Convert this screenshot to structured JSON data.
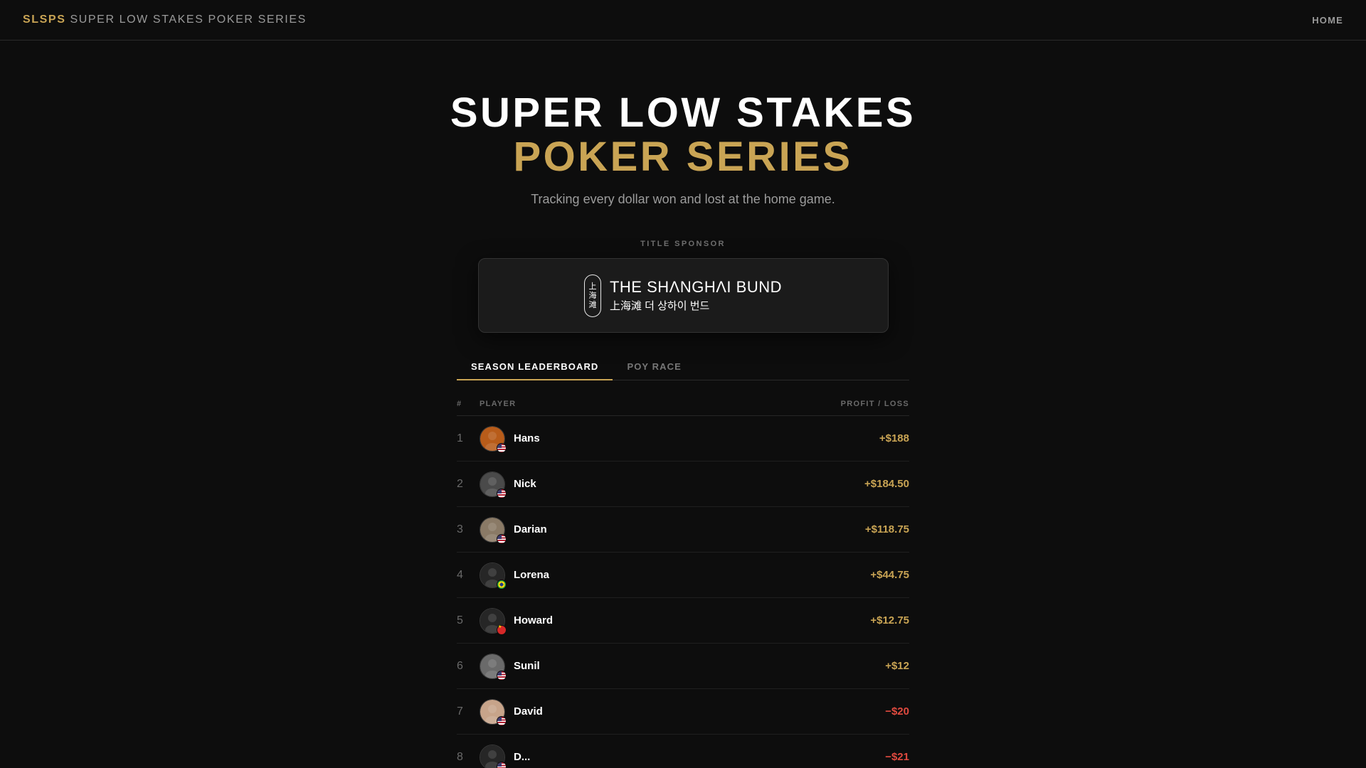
{
  "nav": {
    "brand_short": "SLSPS",
    "brand_long": "SUPER LOW STAKES POKER SERIES",
    "home_label": "HOME"
  },
  "hero": {
    "title_line1": "SUPER LOW STAKES",
    "title_line2": "POKER SERIES",
    "tagline": "Tracking every dollar won and lost at the home game."
  },
  "sponsor": {
    "label": "TITLE SPONSOR",
    "name": "THE SHΛNGHΛI BUND",
    "subtitle": "上海滩  더 상하이 번드",
    "seal_chars": [
      "上",
      "海",
      "滩"
    ]
  },
  "tabs": [
    {
      "label": "SEASON LEADERBOARD",
      "active": true
    },
    {
      "label": "POY RACE",
      "active": false
    }
  ],
  "table": {
    "col_rank": "#",
    "col_player": "PLAYER",
    "col_pl": "PROFIT / LOSS",
    "rows": [
      {
        "rank": "1",
        "name": "Hans",
        "pl": "+$188",
        "flag": "us",
        "avatar_color": "#b85c1a"
      },
      {
        "rank": "2",
        "name": "Nick",
        "pl": "+$184.50",
        "flag": "us",
        "avatar_color": "#4a4a4a"
      },
      {
        "rank": "3",
        "name": "Darian",
        "pl": "+$118.75",
        "flag": "us",
        "avatar_color": "#8a7a66"
      },
      {
        "rank": "4",
        "name": "Lorena",
        "pl": "+$44.75",
        "flag": "br",
        "avatar_color": "#262626"
      },
      {
        "rank": "5",
        "name": "Howard",
        "pl": "+$12.75",
        "flag": "cn",
        "avatar_color": "#262626"
      },
      {
        "rank": "6",
        "name": "Sunil",
        "pl": "+$12",
        "flag": "us",
        "avatar_color": "#6a6a6a"
      },
      {
        "rank": "7",
        "name": "David",
        "pl": "−$20",
        "flag": "us",
        "avatar_color": "#c7a48a"
      },
      {
        "rank": "8",
        "name": "D...",
        "pl": "−$21",
        "flag": "us",
        "avatar_color": "#262626"
      }
    ]
  },
  "colors": {
    "accent": "#c9a454",
    "negative": "#e04a3f",
    "background": "#0d0d0d"
  }
}
